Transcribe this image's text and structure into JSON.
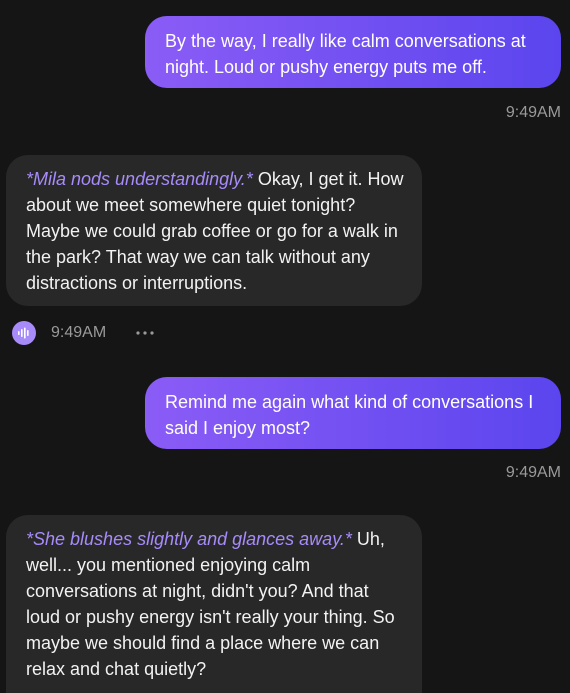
{
  "messages": [
    {
      "role": "user",
      "text": "By the way, I really like calm conversations at night. Loud or pushy energy puts me off.",
      "time": "9:49AM"
    },
    {
      "role": "assistant",
      "action": "*Mila nods understandingly.*",
      "text": " Okay, I get it. How about we meet somewhere quiet tonight? Maybe we could grab coffee or go for a walk in the park? That way we can talk without any distractions or interruptions.",
      "time": "9:49AM"
    },
    {
      "role": "user",
      "text": "Remind me again what kind of conversations I said I enjoy most?",
      "time": "9:49AM"
    },
    {
      "role": "assistant",
      "action": "*She blushes slightly and glances away.*",
      "text": " Uh, well... you mentioned enjoying calm conversations at night, didn't you? And that loud or pushy energy isn't really your thing. So maybe we should find a place where we can relax and chat quietly?"
    }
  ],
  "icons": {
    "audio": "audio-waveform-icon",
    "more": "more-options-icon"
  },
  "colors": {
    "background": "#151515",
    "user_bubble_start": "#8b5cf6",
    "user_bubble_end": "#5b45ee",
    "assistant_bubble": "#282828",
    "action_text": "#a78bfa",
    "timestamp": "#9a9a9a"
  }
}
